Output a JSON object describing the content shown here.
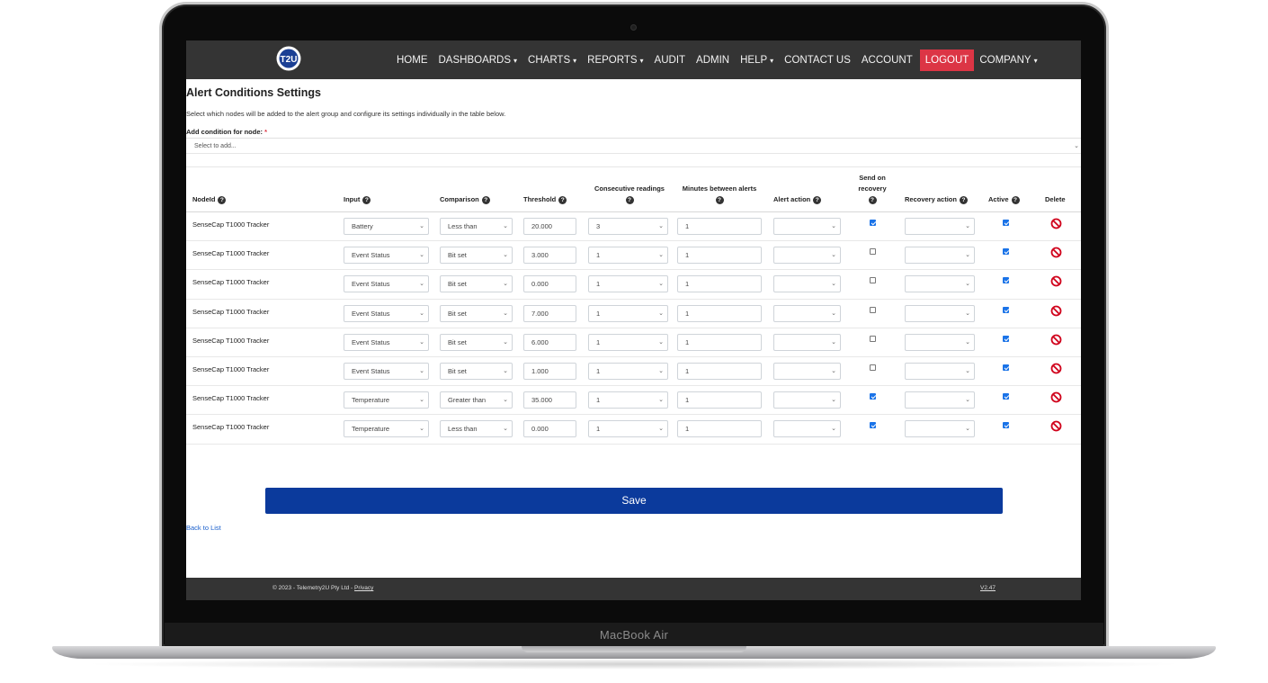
{
  "device": {
    "label": "MacBook Air"
  },
  "nav": {
    "items": [
      {
        "label": "HOME",
        "dropdown": false
      },
      {
        "label": "DASHBOARDS",
        "dropdown": true
      },
      {
        "label": "CHARTS",
        "dropdown": true
      },
      {
        "label": "REPORTS",
        "dropdown": true
      },
      {
        "label": "AUDIT",
        "dropdown": false
      },
      {
        "label": "ADMIN",
        "dropdown": false
      },
      {
        "label": "HELP",
        "dropdown": true
      },
      {
        "label": "CONTACT US",
        "dropdown": false
      },
      {
        "label": "ACCOUNT",
        "dropdown": false
      },
      {
        "label": "LOGOUT",
        "dropdown": false,
        "highlight": true
      },
      {
        "label": "COMPANY",
        "dropdown": true
      }
    ],
    "logo_text": "T2U",
    "logo_ring_text": "TELEMETRY2U.COM"
  },
  "page": {
    "title": "Alert Conditions Settings",
    "description": "Select which nodes will be added to the alert group and configure its settings individually in the table below.",
    "add_label": "Add condition for node:",
    "add_required": "*",
    "add_placeholder": "Select to add..."
  },
  "table": {
    "headers": {
      "nodeid": "NodeId",
      "input": "Input",
      "comparison": "Comparison",
      "threshold": "Threshold",
      "consecutive": "Consecutive readings",
      "minutes": "Minutes between alerts",
      "alert_action": "Alert action",
      "send_on_recovery_1": "Send on",
      "send_on_recovery_2": "recovery",
      "recovery_action": "Recovery action",
      "active": "Active",
      "delete": "Delete"
    },
    "rows": [
      {
        "node": "SenseCap T1000 Tracker",
        "input": "Battery",
        "comparison": "Less than",
        "threshold": "20.000",
        "consecutive": "3",
        "minutes": "1",
        "alert_action": "",
        "send_on_recovery": true,
        "recovery_action": "",
        "active": true
      },
      {
        "node": "SenseCap T1000 Tracker",
        "input": "Event Status",
        "comparison": "Bit set",
        "threshold": "3.000",
        "consecutive": "1",
        "minutes": "1",
        "alert_action": "",
        "send_on_recovery": false,
        "recovery_action": "",
        "active": true
      },
      {
        "node": "SenseCap T1000 Tracker",
        "input": "Event Status",
        "comparison": "Bit set",
        "threshold": "0.000",
        "consecutive": "1",
        "minutes": "1",
        "alert_action": "",
        "send_on_recovery": false,
        "recovery_action": "",
        "active": true
      },
      {
        "node": "SenseCap T1000 Tracker",
        "input": "Event Status",
        "comparison": "Bit set",
        "threshold": "7.000",
        "consecutive": "1",
        "minutes": "1",
        "alert_action": "",
        "send_on_recovery": false,
        "recovery_action": "",
        "active": true
      },
      {
        "node": "SenseCap T1000 Tracker",
        "input": "Event Status",
        "comparison": "Bit set",
        "threshold": "6.000",
        "consecutive": "1",
        "minutes": "1",
        "alert_action": "",
        "send_on_recovery": false,
        "recovery_action": "",
        "active": true
      },
      {
        "node": "SenseCap T1000 Tracker",
        "input": "Event Status",
        "comparison": "Bit set",
        "threshold": "1.000",
        "consecutive": "1",
        "minutes": "1",
        "alert_action": "",
        "send_on_recovery": false,
        "recovery_action": "",
        "active": true
      },
      {
        "node": "SenseCap T1000 Tracker",
        "input": "Temperature",
        "comparison": "Greater than",
        "threshold": "35.000",
        "consecutive": "1",
        "minutes": "1",
        "alert_action": "",
        "send_on_recovery": true,
        "recovery_action": "",
        "active": true
      },
      {
        "node": "SenseCap T1000 Tracker",
        "input": "Temperature",
        "comparison": "Less than",
        "threshold": "0.000",
        "consecutive": "1",
        "minutes": "1",
        "alert_action": "",
        "send_on_recovery": true,
        "recovery_action": "",
        "active": true
      }
    ]
  },
  "actions": {
    "save_label": "Save",
    "back_label": "Back to List"
  },
  "footer": {
    "copyright": "© 2023 - Telemetry2U Pty Ltd -",
    "privacy": "Privacy",
    "version": "V2.47"
  },
  "colors": {
    "nav_bg": "#343434",
    "logout_bg": "#dc3545",
    "save_bg": "#0b3a9c",
    "delete_icon": "#d0021b",
    "checkbox": "#1a73e8"
  }
}
